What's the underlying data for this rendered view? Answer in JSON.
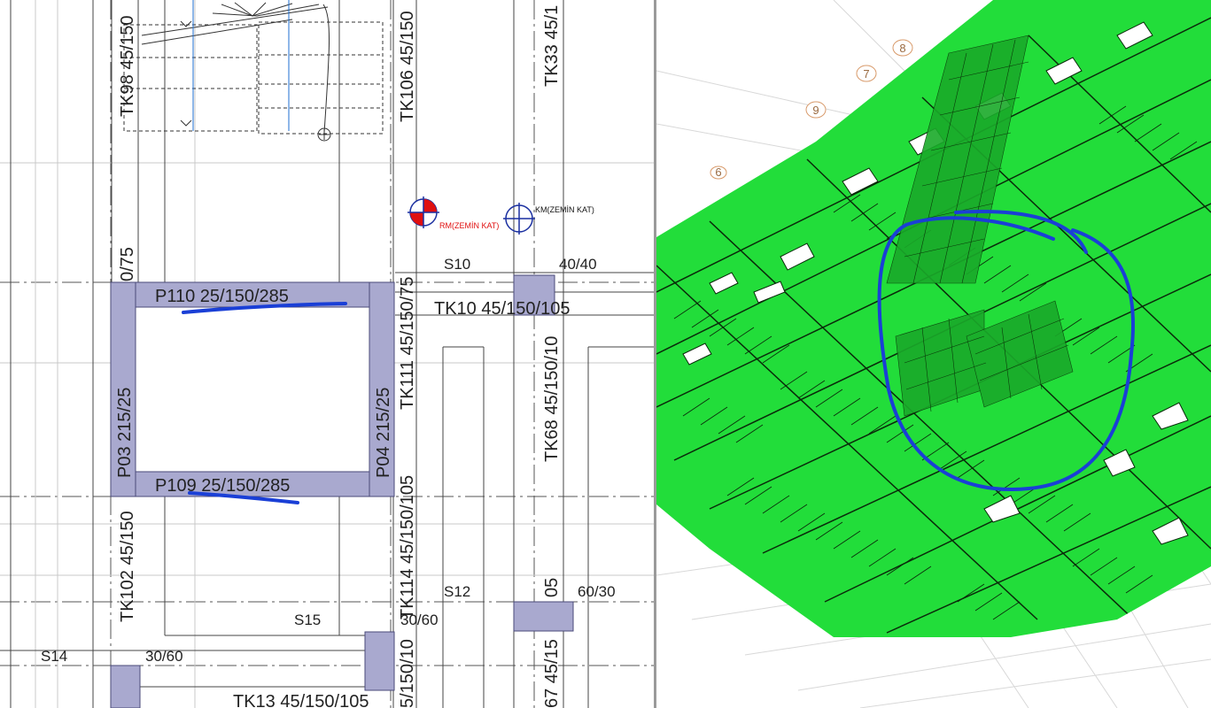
{
  "plan": {
    "beams": {
      "tk98": "TK98 45/150",
      "tk106": "TK106 45/150",
      "tk33": "TK33 45/1",
      "tk10": "TK10 45/150/105",
      "tk111": "TK111 45/150/75",
      "tk68": "TK68 45/150/10",
      "tk102": "TK102 45/150",
      "tk114": "TK114 45/150/105",
      "tk13": "TK13 45/150/105",
      "tk67": "67 45/15",
      "left_top": "0/75",
      "right_bottom": "5/150/10"
    },
    "walls": {
      "p110": "P110 25/150/285",
      "p109": "P109 25/150/285",
      "p03": "P03 215/25",
      "p04": "P04 215/25"
    },
    "columns": {
      "s10": "S10",
      "s10_size": "40/40",
      "s12": "S12",
      "s12_size": "60/30",
      "s15": "S15",
      "s15_size": "30/60",
      "s14": "S14",
      "s14_size": "30/60",
      "frag_05": "05"
    },
    "markers": {
      "rm": "RM(ZEMİN KAT)",
      "km": "KM(ZEMİN KAT)"
    }
  },
  "model": {
    "axis_labels": [
      "9",
      "7",
      "8",
      "6"
    ]
  },
  "colors": {
    "column_fill": "#a9a9cf",
    "structure_green": "#22dd3a",
    "annotation_blue": "#1a3fd6",
    "rm_red": "#e01010"
  }
}
